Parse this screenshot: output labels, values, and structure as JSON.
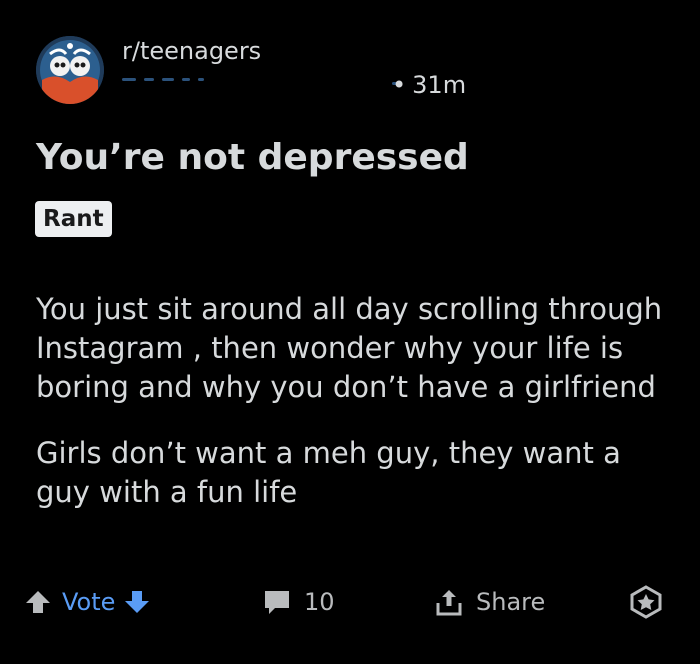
{
  "post": {
    "subreddit": "r/teenagers",
    "time_separator": "•",
    "time_ago": "31m",
    "title": "You’re not depressed",
    "flair": "Rant",
    "body_paragraphs": [
      "You just sit around all day scrolling through Instagram , then wonder why your life is boring and why you don’t have a girlfriend",
      "Girls don’t want a meh guy, they want a guy with a fun life"
    ]
  },
  "actions": {
    "vote_label": "Vote",
    "comment_count": "10",
    "share_label": "Share"
  },
  "icons": {
    "avatar": "subreddit-avatar-icon",
    "upvote": "upvote-arrow-icon",
    "downvote": "downvote-arrow-icon",
    "comments": "comment-bubble-icon",
    "share": "share-icon",
    "award": "award-icon"
  },
  "colors": {
    "background": "#000000",
    "text": "#d7dadc",
    "vote_accent": "#5a9cf5",
    "muted": "#b9bbbd",
    "flair_bg": "#edeff1"
  }
}
